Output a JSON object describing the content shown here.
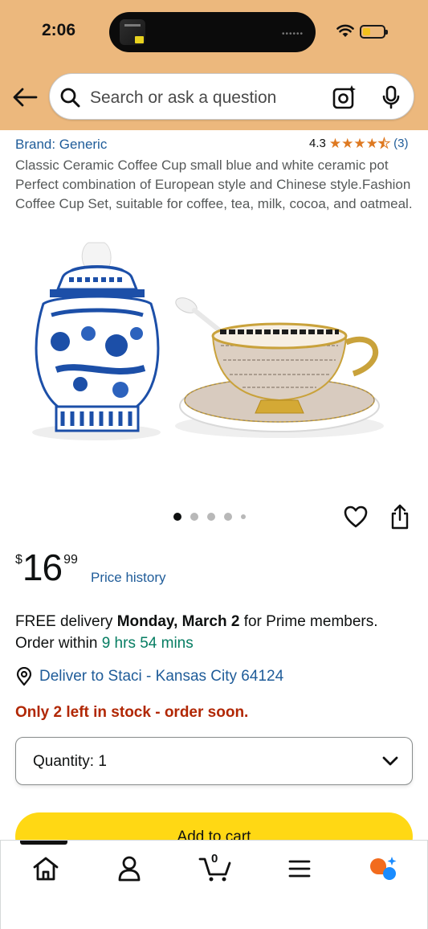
{
  "status_bar": {
    "time": "2:06"
  },
  "search": {
    "placeholder": "Search or ask a question"
  },
  "product": {
    "brand": "Brand: Generic",
    "rating": "4.3",
    "rating_count": "(3)",
    "stars_filled": 4.3,
    "title": "Classic Ceramic Coffee Cup small blue and white ceramic pot Perfect combination of European style and Chinese style.Fashion Coffee Cup Set, suitable for coffee, tea, milk, cocoa, and oatmeal.",
    "image_count": 5,
    "active_image": 1
  },
  "price": {
    "symbol": "$",
    "whole": "16",
    "fraction": "99",
    "history_link": "Price history"
  },
  "delivery": {
    "prefix": "FREE delivery ",
    "date": "Monday, March 2",
    "suffix": " for Prime members.",
    "order_within": "Order within ",
    "countdown": "9 hrs 54 mins",
    "deliver_to": "Deliver to Staci - Kansas City 64124"
  },
  "stock": "Only 2 left in stock - order soon.",
  "quantity": {
    "label": "Quantity: 1"
  },
  "add_to_cart": "Add to cart",
  "nav": {
    "cart_count": "0"
  },
  "colors": {
    "header_bg": "#ecb87d",
    "link": "#1f5c99",
    "star": "#de7921",
    "stock_red": "#b12704",
    "countdown_green": "#067d62",
    "add_to_cart_bg": "#ffd814"
  }
}
